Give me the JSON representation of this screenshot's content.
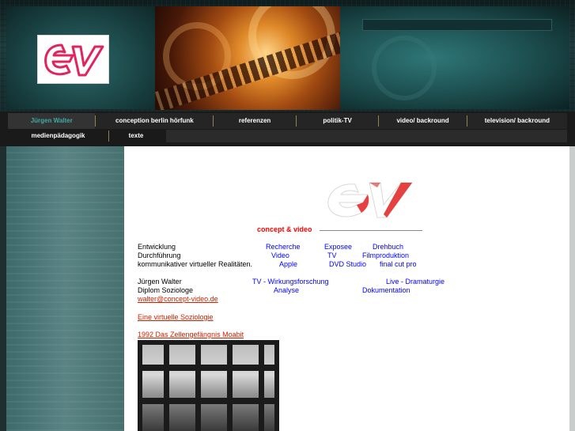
{
  "nav": {
    "row1": [
      {
        "label": "Jürgen Walter",
        "active": true
      },
      {
        "label": "conception berlin hörfunk"
      },
      {
        "label": "referenzen"
      },
      {
        "label": "politik-TV"
      },
      {
        "label": "video/ backround"
      },
      {
        "label": "television/ backround"
      }
    ],
    "row2": [
      {
        "label": "medienpädagogik"
      },
      {
        "label": "texte"
      }
    ]
  },
  "content": {
    "brand": "concept & video",
    "col1": [
      "Entwicklung",
      "Durchführung",
      "kommunikativer virtueller Realitäten."
    ],
    "services": {
      "row1": [
        "Recherche",
        "Exposee",
        "Drehbuch"
      ],
      "row2": [
        "Video",
        "TV",
        "Filmproduktion"
      ],
      "row3": [
        "Apple",
        "DVD Studio",
        "final cut pro"
      ]
    },
    "person": {
      "name": "Jürgen Walter",
      "title": "Diplom Soziologe",
      "email": "walter@concept-video.de"
    },
    "fields": {
      "row1": [
        "TV - Wirkungsforschung",
        "Live - Dramaturgie"
      ],
      "row2": [
        "Analyse",
        "Dokumentation"
      ]
    },
    "link_soziologie": "Eine virtuelle Soziologie",
    "link_moabit": "1992 Das Zellengefängnis Moabit"
  },
  "colors": {
    "accent_teal": "#3fa9a3",
    "link_blue": "#0000ff",
    "brand_red": "#ff0000",
    "link_red": "#cc2200"
  },
  "icons": {
    "header_logo": "cv-logo-mark",
    "content_logo": "cv-logo-mark"
  }
}
